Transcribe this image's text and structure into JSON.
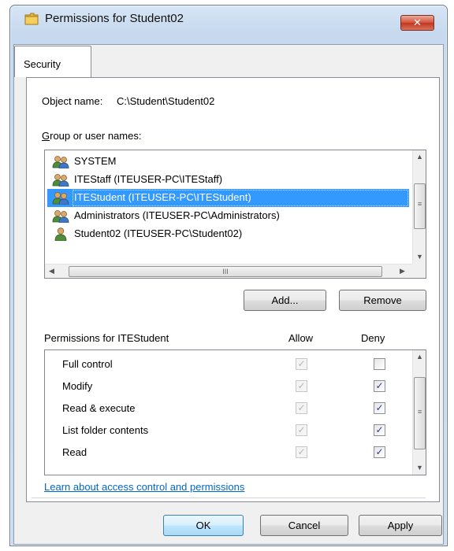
{
  "window": {
    "title": "Permissions for Student02",
    "close_glyph": "✕"
  },
  "tabs": [
    {
      "label": "Security"
    }
  ],
  "object": {
    "label": "Object name:",
    "value": "C:\\Student\\Student02"
  },
  "groups": {
    "label": "Group or user names:",
    "items": [
      {
        "name": "SYSTEM",
        "icon": "group-users-icon",
        "selected": false
      },
      {
        "name": "ITEStaff (ITEUSER-PC\\ITEStaff)",
        "icon": "group-users-icon",
        "selected": false
      },
      {
        "name": "ITEStudent (ITEUSER-PC\\ITEStudent)",
        "icon": "group-users-icon",
        "selected": true
      },
      {
        "name": "Administrators (ITEUSER-PC\\Administrators)",
        "icon": "group-users-icon",
        "selected": false
      },
      {
        "name": "Student02 (ITEUSER-PC\\Student02)",
        "icon": "single-user-icon",
        "selected": false
      }
    ]
  },
  "buttons": {
    "add": "Add...",
    "remove": "Remove",
    "ok": "OK",
    "cancel": "Cancel",
    "apply": "Apply"
  },
  "permissions": {
    "title": "Permissions for ITEStudent",
    "allow_header": "Allow",
    "deny_header": "Deny",
    "check_glyph": "✓",
    "items": [
      {
        "name": "Full control",
        "allow": true,
        "deny": false
      },
      {
        "name": "Modify",
        "allow": true,
        "deny": true
      },
      {
        "name": "Read & execute",
        "allow": true,
        "deny": true
      },
      {
        "name": "List folder contents",
        "allow": true,
        "deny": true
      },
      {
        "name": "Read",
        "allow": true,
        "deny": true
      }
    ]
  },
  "link": {
    "text": "Learn about access control and permissions"
  },
  "colors": {
    "selection": "#3399ff",
    "link": "#0066cc",
    "close_button": "#c2361f"
  }
}
